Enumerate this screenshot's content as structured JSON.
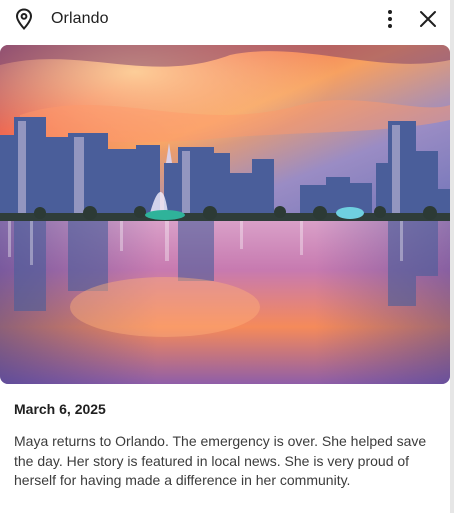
{
  "header": {
    "title": "Orlando",
    "location_icon": "location-pin-icon",
    "more_icon": "more-vert-icon",
    "close_icon": "close-icon"
  },
  "photo": {
    "subject": "city-skyline-at-sunset-over-lake"
  },
  "entry": {
    "date": "March 6, 2025",
    "text": "Maya returns to Orlando. The emergency is over. She helped save the day. Her story is featured in local news. She is very proud of herself for having made a difference in her community."
  },
  "colors": {
    "text_primary": "#1f1f1f",
    "text_body": "#3c3c3c",
    "sky_orange": "#f5874f",
    "sky_purple": "#7f7ab6"
  }
}
